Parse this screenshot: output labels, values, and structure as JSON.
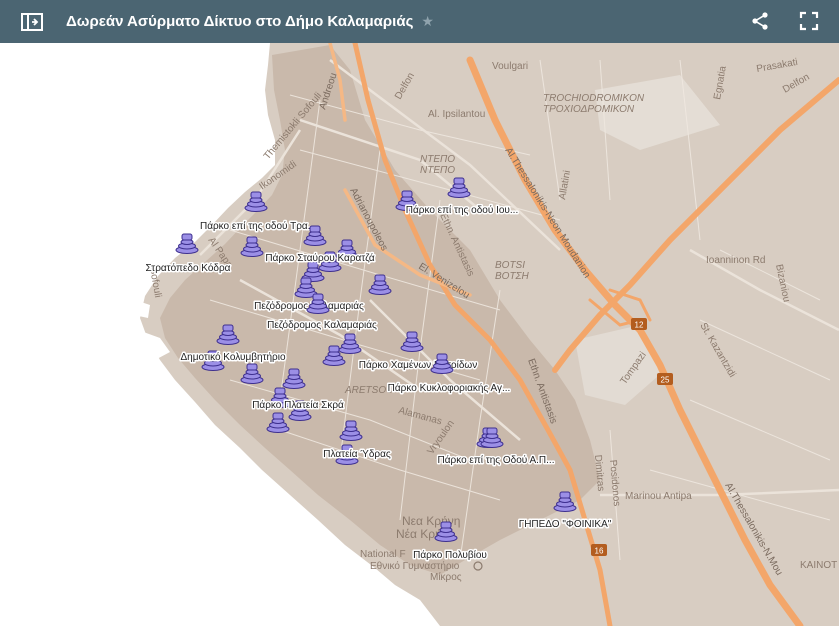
{
  "header": {
    "title": "Δωρεάν Ασύρματο Δίκτυο στο Δήμο Καλαμαριάς",
    "sidebar_icon": "sidebar-toggle-icon",
    "star_icon": "star-icon",
    "share_icon": "share-icon",
    "fullscreen_icon": "fullscreen-icon"
  },
  "colors": {
    "header_bg": "#4b6572",
    "land": "#d6cbbf",
    "city": "#c6b6a8",
    "sea": "#ffffff",
    "highway": "#f2a36b",
    "marker": "#9b8fe6"
  },
  "markers": [
    {
      "label": "Πάρκο επί της οδού Τρα..."
    },
    {
      "label": "Πάρκο επί της οδού Ιου..."
    },
    {
      "label": "Στρατόπεδο Κόδρα"
    },
    {
      "label": "Πάρκο Σταύρου Καρατζά"
    },
    {
      "label": "Πεζόδρομος Καλαμαριάς"
    },
    {
      "label": "Πεζόδρομος Καλαμαριάς"
    },
    {
      "label": "Δημοτικό Κολυμβητήριο"
    },
    {
      "label": "Πάρκο Χαμένων Πατρίδων"
    },
    {
      "label": "Πάρκο Κυκλοφοριακής Αγ..."
    },
    {
      "label": "Πάρκο Πλατεία Σκρά"
    },
    {
      "label": "Πλατεία Ύδρας"
    },
    {
      "label": "Πάρκο επί της Οδού Α.Π..."
    },
    {
      "label": "ΓΗΠΕΔΟ \"ΦΟΙΝΙΚΑ\""
    },
    {
      "label": "Πάρκο Πολυβίου"
    }
  ],
  "map_labels": {
    "andreou": "Andreou",
    "voulgari": "Voulgari",
    "prasakati": "Prasakati",
    "egnatia": "Egnatia",
    "delfon1": "Delfon",
    "delfon2": "Delfon",
    "ipsilantou": "Al. Ipsilantou",
    "trochiodromikon": "TROCHIODROMIKON",
    "trochiodromikon_gr": "ΤΡΟΧΙΟΔΡΟΜΙΚΟΝ",
    "themistokli": "Themistokli Sofouli",
    "ikonomidi": "Ikonomidi",
    "ntepo": "ΝΤΕΠΟ",
    "ntepo_gr": "ΝΤΕΠΟ",
    "allatini": "Allatini",
    "thessaloniki_neon": "Al.Thessalonikis-Neon Moudanion",
    "adrianoupoleos": "Adrianoupoleos",
    "antistasis": "Ethn. Antistasis",
    "votsi": "ΒΟΤSI",
    "votsi_gr": "ΒΟΤΣΗ",
    "venizelou": "El. Venizelou",
    "ioanninon": "Ioanninon Rd",
    "bizaniou": "Bizaniou",
    "kazantzidi": "St. Kazantzidi",
    "al_papa": "Al Papa",
    "sofouli": "Sofouli",
    "tompazi": "Tompazi",
    "aretsou": "ΑRETSOU",
    "alamanas": "Alamanas",
    "vryoulon": "Vryoulon",
    "ethn_antistasis": "Ethn. Antistasis",
    "dimitras": "Dimitras",
    "posidonos": "Posidonos",
    "marinou": "Marinou Antipa",
    "thess_lower": "Al.Thessalonikis-N.Mou",
    "nea_krini": "Νεα Κρήνη",
    "nea_krini_gr": "Νέα Κρήνη",
    "national": "National F",
    "ethniko": "Εθνικό Γυμναστήριο",
    "mikros": "Μίκρος",
    "kainot": "ΚΑΙΝΟΤ",
    "shield_12": "12",
    "shield_25": "25",
    "shield_16": "16"
  }
}
